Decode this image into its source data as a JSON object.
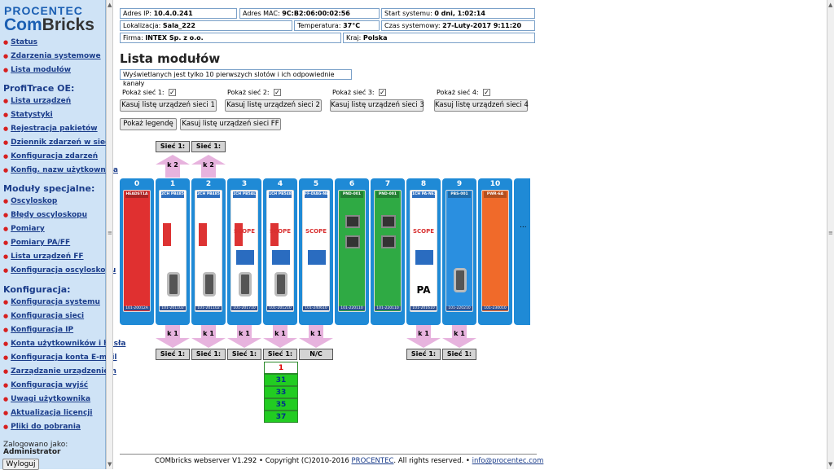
{
  "logo": {
    "line1": "PROCENTEC",
    "line2a": "Com",
    "line2b": "Bricks"
  },
  "sidebar": {
    "links_top": [
      "Status",
      "Zdarzenia systemowe",
      "Lista modułów"
    ],
    "section1": "ProfiTrace OE:",
    "links1": [
      "Lista urządzeń",
      "Statystyki",
      "Rejestracja pakietów",
      "Dziennik zdarzeń w sieci",
      "Konfiguracja zdarzeń",
      "Konfig. nazw użytkownika"
    ],
    "section2": "Moduły specjalne:",
    "links2": [
      "Oscyloskop",
      "Błędy oscyloskopu",
      "Pomiary",
      "Pomiary PA/FF",
      "Lista urządzeń FF",
      "Konfiguracja oscyloskopu"
    ],
    "section3": "Konfiguracja:",
    "links3": [
      "Konfiguracja systemu",
      "Konfiguracja sieci",
      "Konfiguracja IP",
      "Konta użytkowników i hasła",
      "Konfiguracja konta E-mail",
      "Zarządzanie urządzeniem",
      "Konfiguracja wyjść",
      "Uwagi użytkownika",
      "Aktualizacja licencji",
      "Pliki do pobrania"
    ],
    "logged_label": "Zalogowano jako:",
    "logged_user": "Administrator",
    "logout": "Wyloguj"
  },
  "info": {
    "ip_label": "Adres IP:",
    "ip": "10.4.0.241",
    "mac_label": "Adres MAC:",
    "mac": "9C:B2:06:00:02:56",
    "start_label": "Start systemu:",
    "start": "0 dni, 1:02:14",
    "loc_label": "Lokalizacja:",
    "loc": "Sala_222",
    "temp_label": "Temperatura:",
    "temp": "37°C",
    "time_label": "Czas systemowy:",
    "time": "27-Luty-2017 9:11:20",
    "firm_label": "Firma:",
    "firm": "INTEX Sp. z o.o.",
    "country_label": "Kraj:",
    "country": "Polska"
  },
  "page_title": "Lista modułów",
  "note": "Wyświetlanych jest tylko 10 pierwszych slotów i ich odpowiednie kanały",
  "networks": [
    {
      "show": "Pokaż sieć 1:",
      "clear": "Kasuj listę urządzeń sieci 1",
      "checked": true
    },
    {
      "show": "Pokaż sieć 2:",
      "clear": "Kasuj listę urządzeń sieci 2",
      "checked": true
    },
    {
      "show": "Pokaż sieć 3:",
      "clear": "Kasuj listę urządzeń sieci 3",
      "checked": true
    },
    {
      "show": "Pokaż sieć 4:",
      "clear": "Kasuj listę urządzeń sieci 4",
      "checked": true
    }
  ],
  "legend_button": "Pokaż legendę",
  "clear_ff_button": "Kasuj listę urządzeń sieci FF",
  "top_channels": [
    {
      "net": "Sieć 1:",
      "k": "k 2"
    },
    {
      "net": "Sieć 1:",
      "k": "k 2"
    }
  ],
  "modules": [
    {
      "num": "0",
      "tag": "HEADST1A",
      "code": "101-20012A",
      "color": "#e03030",
      "frame": "#1f8ad6"
    },
    {
      "num": "1",
      "tag": "2CH PB485",
      "code": "101-201102",
      "color": "#ffffff",
      "frame": "#1f8ad6"
    },
    {
      "num": "2",
      "tag": "2CH PB485",
      "code": "101-201102",
      "color": "#ffffff",
      "frame": "#1f8ad6"
    },
    {
      "num": "3",
      "tag": "1CH PB5ALT",
      "code": "101-201710",
      "color": "#ffffff",
      "frame": "#1f8ad6"
    },
    {
      "num": "4",
      "tag": "1CH PB5485",
      "code": "101-201210",
      "color": "#ffffff",
      "frame": "#1f8ad6"
    },
    {
      "num": "5",
      "tag": "FF-DIAG-NEX",
      "code": "101-240610",
      "color": "#ffffff",
      "frame": "#1f8ad6"
    },
    {
      "num": "6",
      "tag": "PND-001",
      "code": "101-220110",
      "color": "#2faa44",
      "frame": "#1f8ad6"
    },
    {
      "num": "7",
      "tag": "PND-001",
      "code": "101-220110",
      "color": "#2faa44",
      "frame": "#1f8ad6"
    },
    {
      "num": "8",
      "tag": "1CH PA-NEX",
      "code": "101-201610",
      "color": "#ffffff",
      "frame": "#1f8ad6"
    },
    {
      "num": "9",
      "tag": "PBS-001",
      "code": "101-220210",
      "color": "#2a8fe0",
      "frame": "#1f8ad6"
    },
    {
      "num": "10",
      "tag": "PWR-6A",
      "code": "101-230010",
      "color": "#f06a2a",
      "frame": "#1f8ad6"
    }
  ],
  "scope_label": "SCOPE",
  "pa_label": "PA",
  "more": "...",
  "bottom_channels": [
    {
      "k": "k 1",
      "net": "Sieć 1:"
    },
    {
      "k": "k 1",
      "net": "Sieć 1:"
    },
    {
      "k": "k 1",
      "net": "Sieć 1:"
    },
    {
      "k": "k 1",
      "net": "Sieć 1:"
    },
    {
      "k": "k 1",
      "net": "N/C"
    },
    {
      "k": "k 1",
      "net": "Sieć 1:"
    },
    {
      "k": "k 1",
      "net": "Sieć 1:"
    }
  ],
  "addresses": [
    "1",
    "31",
    "33",
    "35",
    "37"
  ],
  "footer": {
    "text": "COMbricks webserver V1.292 • Copyright (C)2010-2016 ",
    "link1": "PROCENTEC",
    "mid": ". All rights reserved. • ",
    "link2": "info@procentec.com"
  }
}
